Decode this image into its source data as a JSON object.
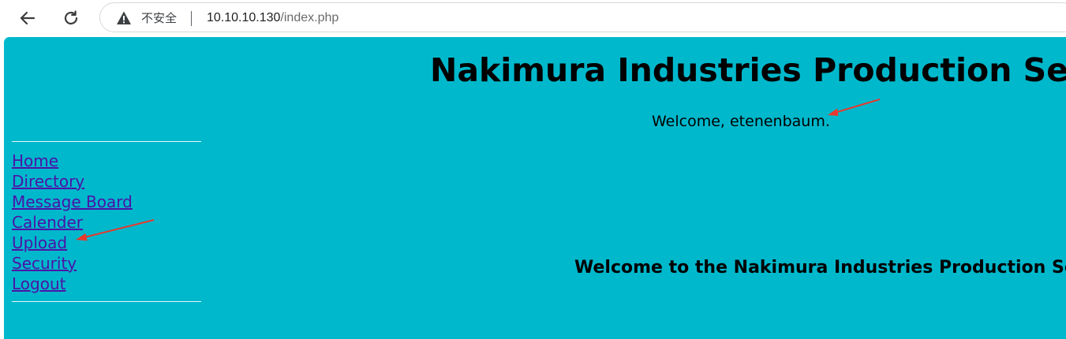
{
  "browser": {
    "security_label": "不安全",
    "url_host": "10.10.10.130",
    "url_path": "/index.php",
    "icons": {
      "back": "back-arrow-icon",
      "reload": "reload-icon",
      "warning": "warning-triangle-icon"
    }
  },
  "page": {
    "header": "Nakimura Industries Production Server",
    "welcome_user": "Welcome, etenenbaum.",
    "main_welcome": "Welcome to the Nakimura Industries Production Serv",
    "background_color": "#00b8cc",
    "link_color": "#4b13a7",
    "annotation_color": "#e8382d"
  },
  "nav": {
    "items": [
      {
        "label": "Home"
      },
      {
        "label": "Directory"
      },
      {
        "label": "Message Board"
      },
      {
        "label": "Calender"
      },
      {
        "label": "Upload"
      },
      {
        "label": "Security"
      },
      {
        "label": "Logout"
      }
    ]
  }
}
